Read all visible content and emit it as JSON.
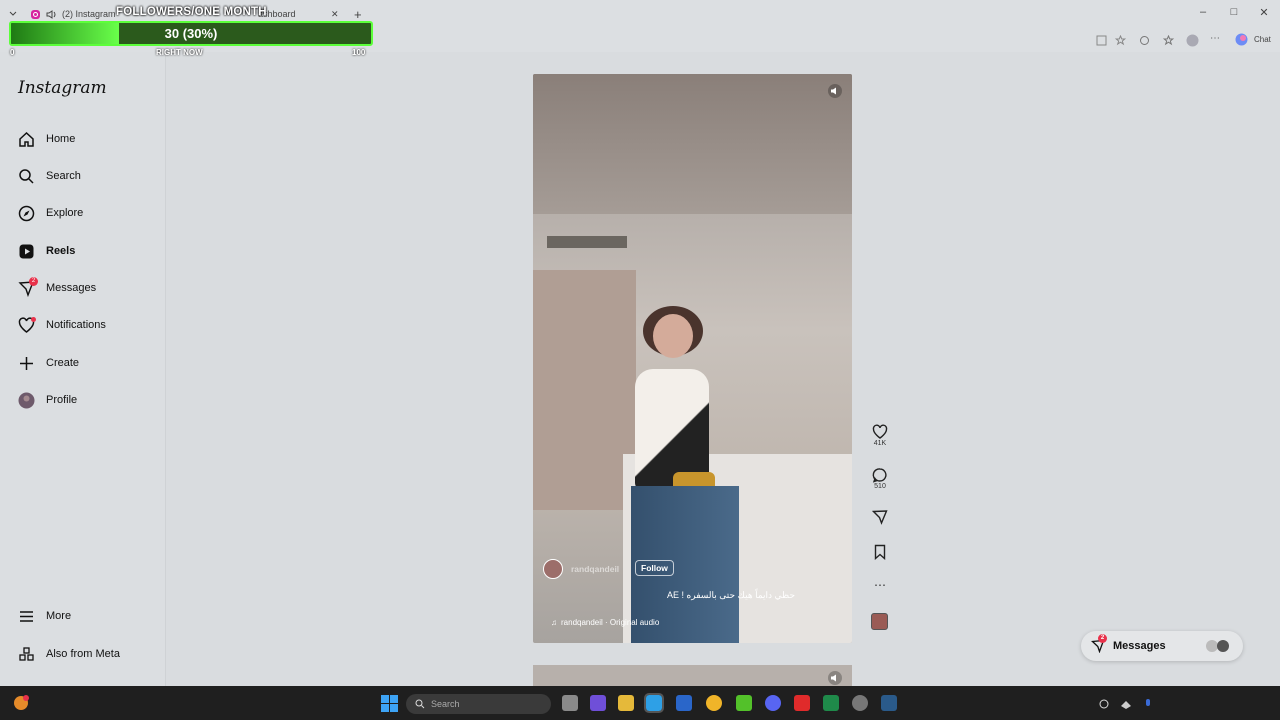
{
  "browser": {
    "tabs": [
      {
        "label": "(2) Instagram"
      },
      {
        "label": "ashboard"
      }
    ],
    "new_tab": "+",
    "window_controls": {
      "minimize": "–",
      "maximize": "□",
      "close": "✕"
    },
    "copilot_label": "Chat"
  },
  "overlay": {
    "title": "FOLLOWERS/ONE MONTH",
    "value": "30 (30%)",
    "progress": 0.3,
    "min": "0",
    "current_label": "RIGHT NOW",
    "max": "100"
  },
  "sidebar": {
    "logo": "Instagram",
    "items": [
      {
        "label": "Home",
        "icon": "home-icon"
      },
      {
        "label": "Search",
        "icon": "search-icon"
      },
      {
        "label": "Explore",
        "icon": "compass-icon"
      },
      {
        "label": "Reels",
        "icon": "reels-icon"
      },
      {
        "label": "Messages",
        "icon": "messenger-icon",
        "badge": "2"
      },
      {
        "label": "Notifications",
        "icon": "heart-icon"
      },
      {
        "label": "Create",
        "icon": "plus-icon"
      },
      {
        "label": "Profile",
        "icon": "avatar-icon"
      }
    ],
    "bottom": [
      {
        "label": "More",
        "icon": "menu-icon"
      },
      {
        "label": "Also from Meta",
        "icon": "meta-apps-icon"
      }
    ]
  },
  "reel": {
    "username": "randqandeil",
    "follow": "Follow",
    "caption": "حظي دايماً هيك حتى بالسفره ! AE",
    "audio": "randqandeil · Original audio",
    "likes": "41K",
    "comments": "510"
  },
  "messages": {
    "label": "Messages",
    "badge": "2"
  },
  "taskbar": {
    "search_placeholder": "Search"
  },
  "colors": {
    "accent": "#5cff3a",
    "badge": "#e8324b"
  }
}
